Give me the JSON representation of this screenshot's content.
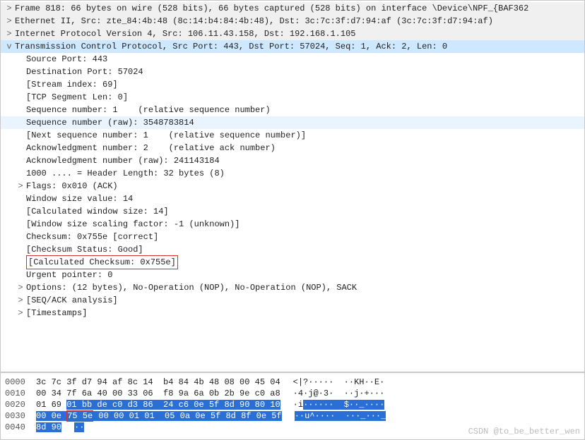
{
  "tree": [
    {
      "cls": "top",
      "tw": ">",
      "key": "tree.0.text",
      "text": "Frame 818: 66 bytes on wire (528 bits), 66 bytes captured (528 bits) on interface \\Device\\NPF_{BAF362"
    },
    {
      "cls": "top",
      "tw": ">",
      "key": "tree.1.text",
      "text": "Ethernet II, Src: zte_84:4b:48 (8c:14:b4:84:4b:48), Dst: 3c:7c:3f:d7:94:af (3c:7c:3f:d7:94:af)"
    },
    {
      "cls": "top",
      "tw": ">",
      "key": "tree.2.text",
      "text": "Internet Protocol Version 4, Src: 106.11.43.158, Dst: 192.168.1.105"
    },
    {
      "cls": "sel",
      "tw": "v",
      "key": "tree.3.text",
      "text": "Transmission Control Protocol, Src Port: 443, Dst Port: 57024, Seq: 1, Ack: 2, Len: 0"
    },
    {
      "cls": "ind1",
      "tw": " ",
      "key": "tree.4.text",
      "text": "Source Port: 443"
    },
    {
      "cls": "ind1",
      "tw": " ",
      "key": "tree.5.text",
      "text": "Destination Port: 57024"
    },
    {
      "cls": "ind1",
      "tw": " ",
      "key": "tree.6.text",
      "text": "[Stream index: 69]"
    },
    {
      "cls": "ind1",
      "tw": " ",
      "key": "tree.7.text",
      "text": "[TCP Segment Len: 0]"
    },
    {
      "cls": "ind1",
      "tw": " ",
      "key": "tree.8.text",
      "text": "Sequence number: 1    (relative sequence number)"
    },
    {
      "cls": "ind1 hl",
      "tw": " ",
      "key": "tree.9.text",
      "text": "Sequence number (raw): 3548783814"
    },
    {
      "cls": "ind1",
      "tw": " ",
      "key": "tree.10.text",
      "text": "[Next sequence number: 1    (relative sequence number)]"
    },
    {
      "cls": "ind1",
      "tw": " ",
      "key": "tree.11.text",
      "text": "Acknowledgment number: 2    (relative ack number)"
    },
    {
      "cls": "ind1",
      "tw": " ",
      "key": "tree.12.text",
      "text": "Acknowledgment number (raw): 241143184"
    },
    {
      "cls": "ind1",
      "tw": " ",
      "key": "tree.13.text",
      "text": "1000 .... = Header Length: 32 bytes (8)"
    },
    {
      "cls": "ind1",
      "tw": ">",
      "key": "tree.14.text",
      "text": "Flags: 0x010 (ACK)"
    },
    {
      "cls": "ind1",
      "tw": " ",
      "key": "tree.15.text",
      "text": "Window size value: 14"
    },
    {
      "cls": "ind1",
      "tw": " ",
      "key": "tree.16.text",
      "text": "[Calculated window size: 14]"
    },
    {
      "cls": "ind1",
      "tw": " ",
      "key": "tree.17.text",
      "text": "[Window size scaling factor: -1 (unknown)]"
    },
    {
      "cls": "ind1",
      "tw": " ",
      "key": "tree.18.text",
      "text": "Checksum: 0x755e [correct]"
    },
    {
      "cls": "ind1",
      "tw": " ",
      "key": "tree.19.text",
      "text": "[Checksum Status: Good]"
    },
    {
      "cls": "ind1",
      "tw": " ",
      "key": "tree.20.text",
      "text": "[Calculated Checksum: 0x755e]",
      "boxed": true
    },
    {
      "cls": "ind1",
      "tw": " ",
      "key": "tree.21.text",
      "text": "Urgent pointer: 0"
    },
    {
      "cls": "ind1",
      "tw": ">",
      "key": "tree.22.text",
      "text": "Options: (12 bytes), No-Operation (NOP), No-Operation (NOP), SACK"
    },
    {
      "cls": "ind1",
      "tw": ">",
      "key": "tree.23.text",
      "text": "[SEQ/ACK analysis]"
    },
    {
      "cls": "ind1",
      "tw": ">",
      "key": "tree.24.text",
      "text": "[Timestamps]"
    }
  ],
  "hex": {
    "rows": [
      {
        "off": "0000",
        "b": [
          [
            "3c 7c 3f d7 94 af 8c 14  b4 84 4b 48 08 00 45 04",
            ""
          ]
        ],
        "a": [
          [
            "<|?·····  ··KH··E·",
            ""
          ]
        ]
      },
      {
        "off": "0010",
        "b": [
          [
            "00 34 7f 6a 40 00 33 06  f8 9a 6a 0b 2b 9e c0 a8",
            ""
          ]
        ],
        "a": [
          [
            "·4·j@·3·  ··j·+···",
            ""
          ]
        ]
      },
      {
        "off": "0020",
        "b": [
          [
            "01 69 ",
            ""
          ],
          [
            "01 bb de c0 d3 86  24 c6 0e 5f 8d 90 80 10",
            "hb"
          ]
        ],
        "a": [
          [
            "·i",
            ""
          ],
          [
            "······  $··_····",
            "hb"
          ]
        ]
      },
      {
        "off": "0030",
        "b": [
          [
            "00 0e ",
            "hb"
          ],
          [
            "75 5e",
            "hb rb"
          ],
          [
            " 00 00 01 01  05 0a 0e 5f 8d 8f 0e 5f",
            "hb"
          ]
        ],
        "a": [
          [
            "··",
            "hb"
          ],
          [
            "u^",
            "hb"
          ],
          [
            "····  ···_···_",
            "hb"
          ]
        ]
      },
      {
        "off": "0040",
        "b": [
          [
            "8d 90",
            "hb"
          ]
        ],
        "a": [
          [
            "··",
            "hb"
          ]
        ]
      }
    ]
  },
  "watermark": "CSDN @to_be_better_wen"
}
